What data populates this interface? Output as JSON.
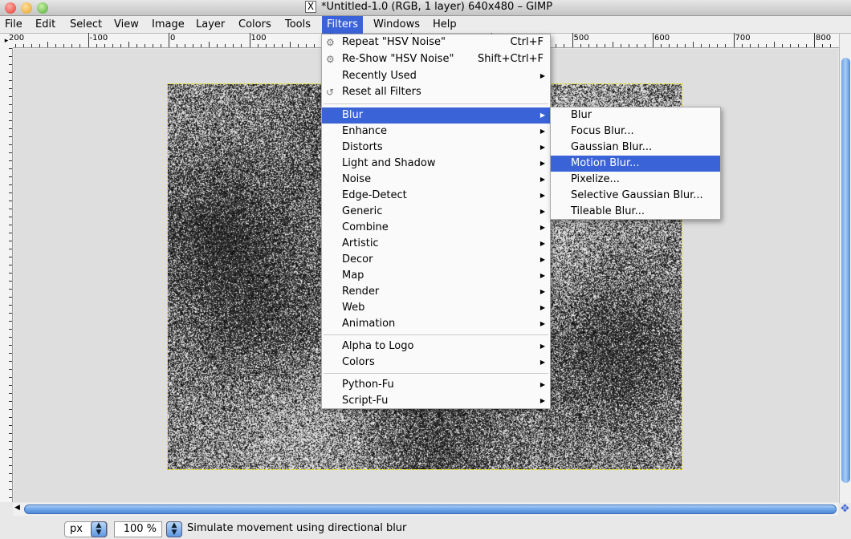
{
  "window": {
    "title": "*Untitled-1.0 (RGB, 1 layer) 640x480 – GIMP",
    "x_icon": "X"
  },
  "menubar": [
    {
      "label": "File"
    },
    {
      "label": "Edit"
    },
    {
      "label": "Select"
    },
    {
      "label": "View"
    },
    {
      "label": "Image"
    },
    {
      "label": "Layer"
    },
    {
      "label": "Colors"
    },
    {
      "label": "Tools"
    },
    {
      "label": "Filters"
    },
    {
      "label": "Windows"
    },
    {
      "label": "Help"
    }
  ],
  "ruler": {
    "labels": [
      "200",
      "-100",
      "0",
      "100",
      "500",
      "600",
      "700",
      "800"
    ]
  },
  "filters_menu": {
    "top": [
      {
        "label": "Repeat \"HSV Noise\"",
        "accel": "Ctrl+F",
        "icon": "gear-icon"
      },
      {
        "label": "Re-Show \"HSV Noise\"",
        "accel": "Shift+Ctrl+F",
        "icon": "reshow-icon"
      },
      {
        "label": "Recently Used",
        "submenu": true
      },
      {
        "label": "Reset all Filters",
        "icon": "reset-icon"
      }
    ],
    "groups": [
      {
        "label": "Blur",
        "selected": true
      },
      {
        "label": "Enhance"
      },
      {
        "label": "Distorts"
      },
      {
        "label": "Light and Shadow"
      },
      {
        "label": "Noise"
      },
      {
        "label": "Edge-Detect"
      },
      {
        "label": "Generic"
      },
      {
        "label": "Combine"
      },
      {
        "label": "Artistic"
      },
      {
        "label": "Decor"
      },
      {
        "label": "Map"
      },
      {
        "label": "Render"
      },
      {
        "label": "Web"
      },
      {
        "label": "Animation"
      }
    ],
    "scripts1": [
      {
        "label": "Alpha to Logo"
      },
      {
        "label": "Colors"
      }
    ],
    "scripts2": [
      {
        "label": "Python-Fu"
      },
      {
        "label": "Script-Fu"
      }
    ]
  },
  "blur_submenu": [
    {
      "label": "Blur"
    },
    {
      "label": "Focus Blur..."
    },
    {
      "label": "Gaussian Blur..."
    },
    {
      "label": "Motion Blur...",
      "selected": true
    },
    {
      "label": "Pixelize..."
    },
    {
      "label": "Selective Gaussian Blur..."
    },
    {
      "label": "Tileable Blur..."
    }
  ],
  "statusbar": {
    "unit": "px",
    "zoom": "100 %",
    "message": "Simulate movement using directional blur"
  },
  "colors": {
    "accent": "#3a63d8",
    "selection": "#e0d800"
  }
}
